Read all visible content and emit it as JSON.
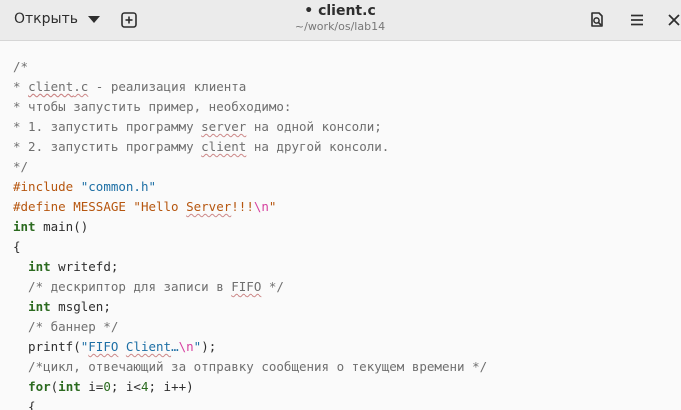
{
  "header": {
    "open_label": "Открыть",
    "title": "• client.c",
    "subtitle": "~/work/os/lab14",
    "icons": [
      "chevron-down-icon",
      "new-tab-icon",
      "find-icon",
      "menu-icon",
      "close-icon"
    ]
  },
  "code": {
    "lines": [
      "/*",
      "* client.c - реализация клиента",
      "* чтобы запустить пример, необходимо:",
      "* 1. запустить программу server на одной консоли;",
      "* 2. запустить программу client на другой консоли.",
      "*/",
      "#include \"common.h\"",
      "#define MESSAGE \"Hello Server!!!\\n\"",
      "int main()",
      "{",
      "  int writefd;",
      "  /* дескриптор для записи в FIFO */",
      "  int msglen;",
      "  /* баннер */",
      "  printf(\"FIFO Client…\\n\");",
      "  /*цикл, отвечающий за отправку сообщения о текущем времени */",
      "  for(int i=0; i<4; i++)",
      "  {"
    ]
  },
  "colors": {
    "comment": "#6f6f6f",
    "preprocessor": "#b6560f",
    "string": "#1d6fa5",
    "keyword": "#2b6a1f",
    "header_bg": "#ebebeb",
    "editor_bg": "#fafafa"
  }
}
